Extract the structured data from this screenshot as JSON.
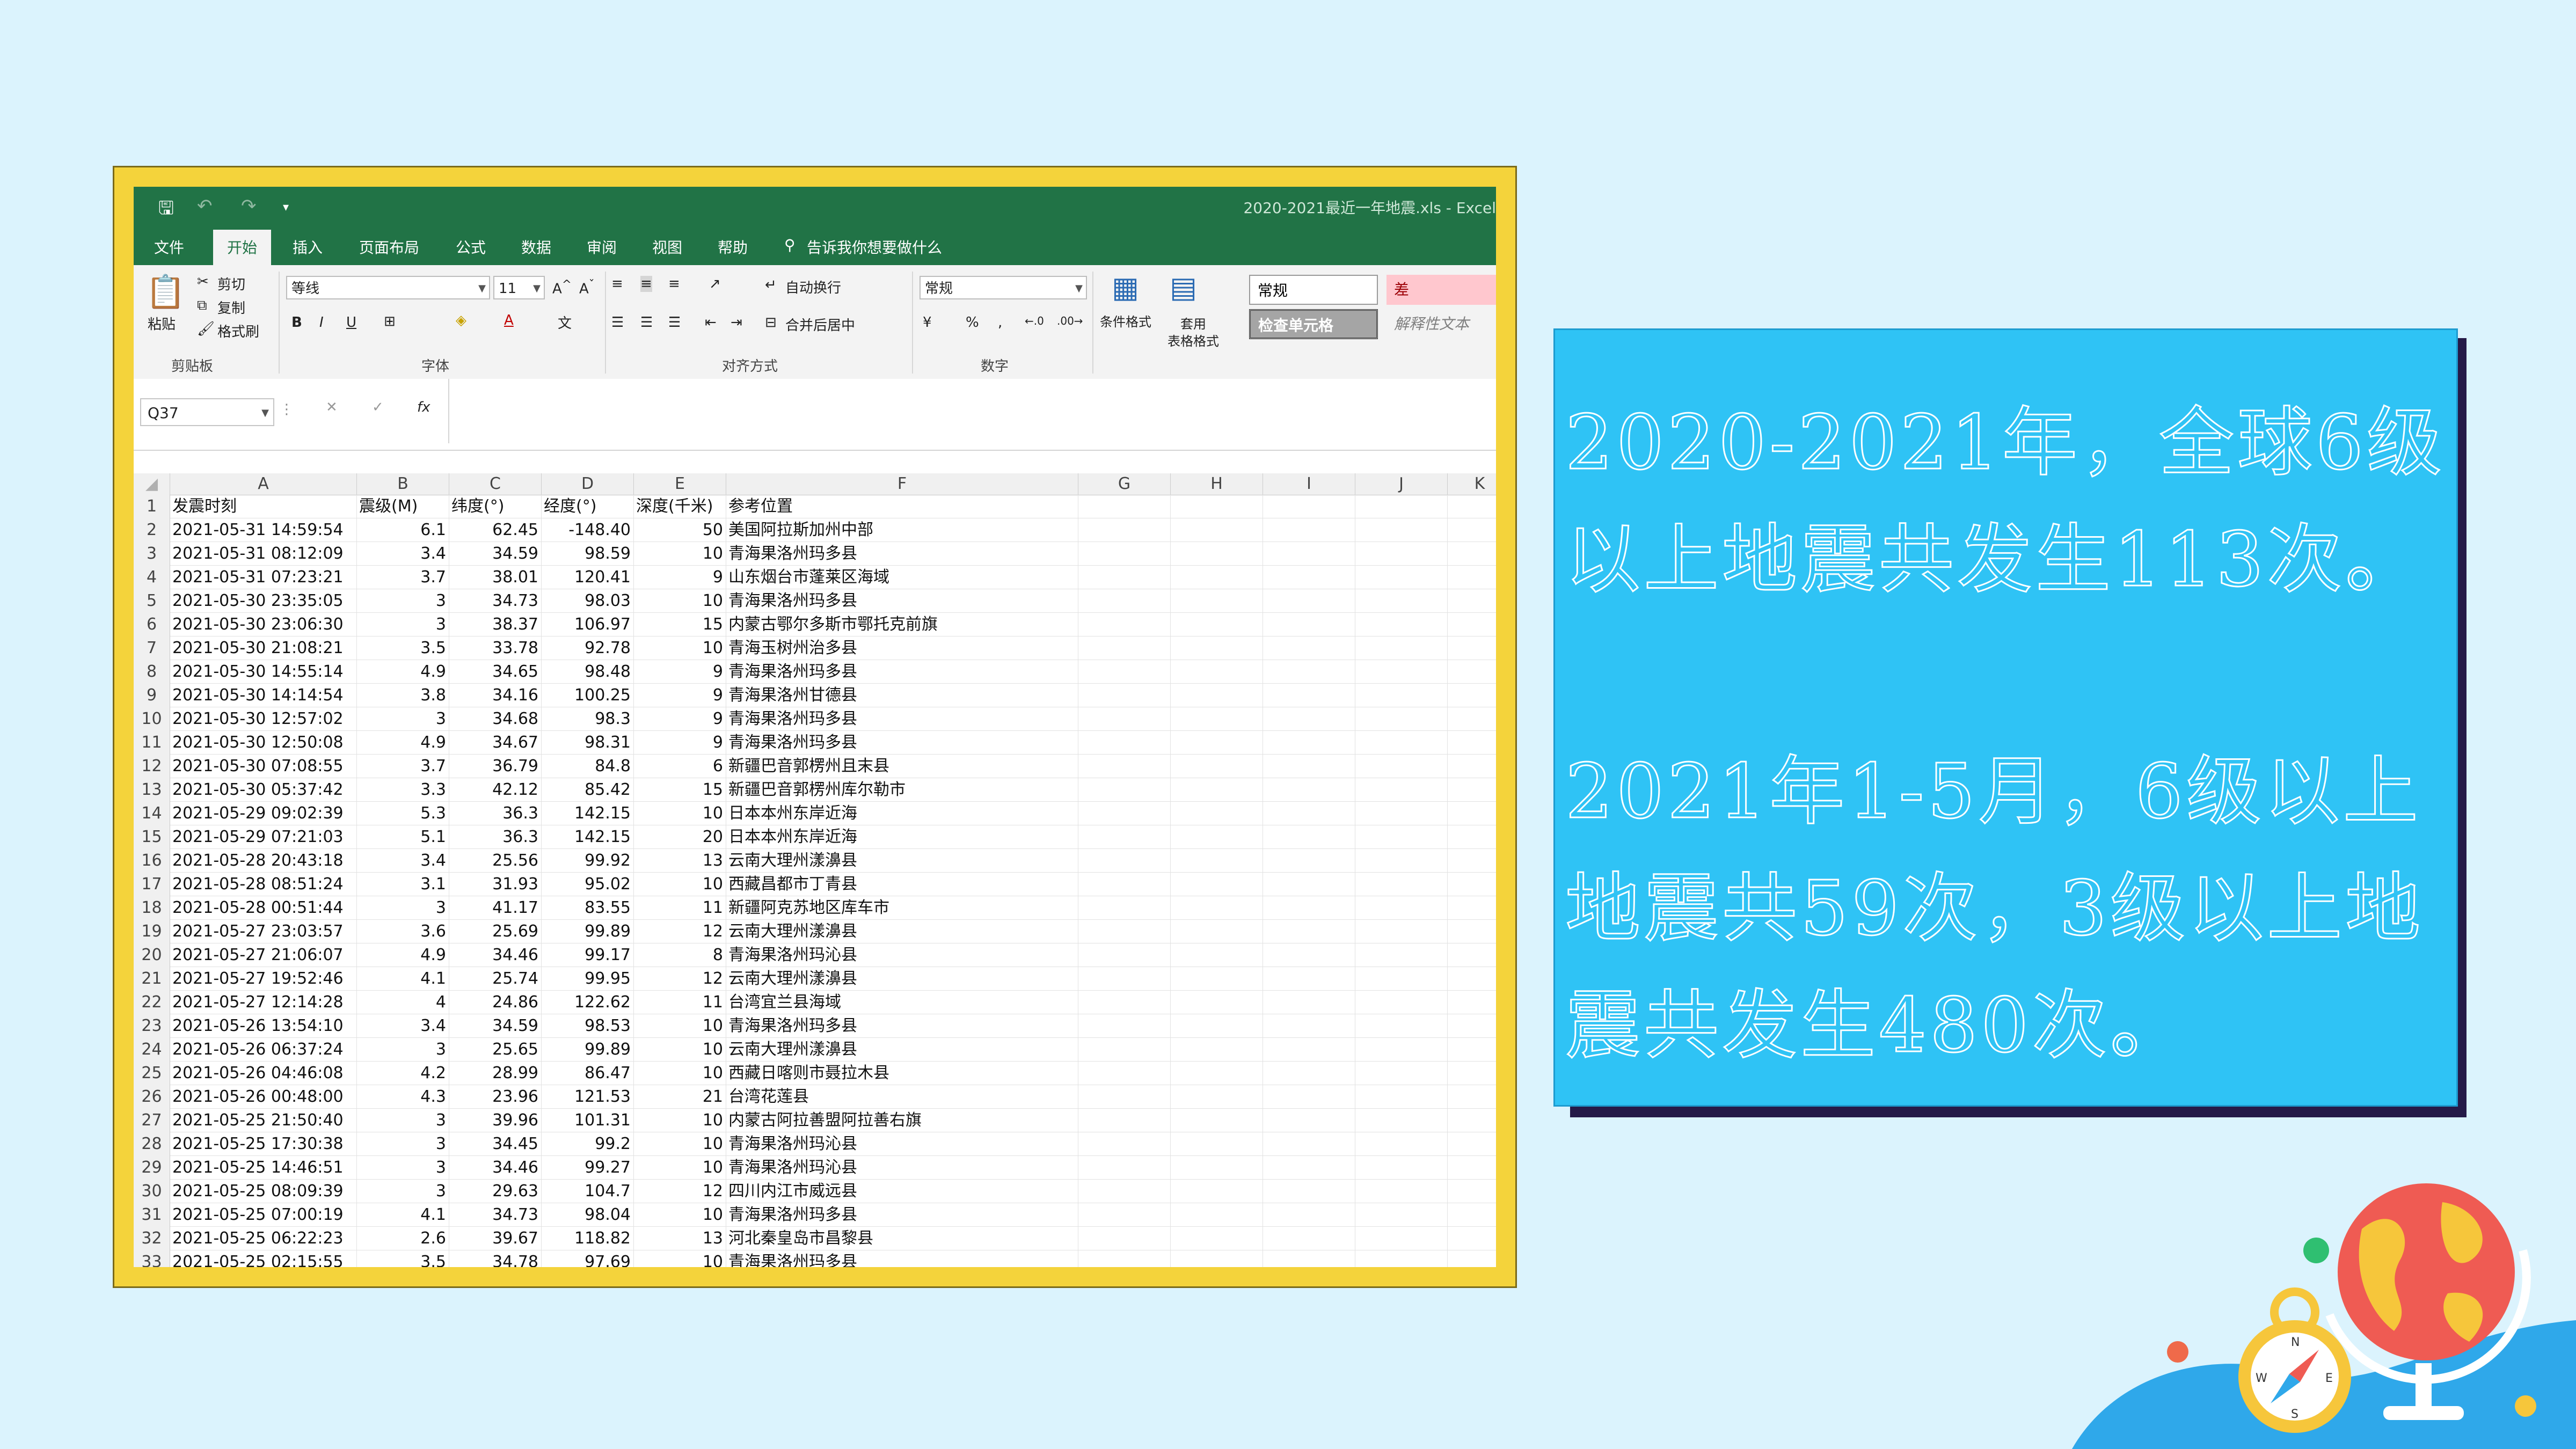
{
  "excel": {
    "doc_title": "2020-2021最近一年地震.xls  -  Excel",
    "tabs": [
      "文件",
      "开始",
      "插入",
      "页面布局",
      "公式",
      "数据",
      "审阅",
      "视图",
      "帮助"
    ],
    "active_tab": "开始",
    "tell_me": "告诉我你想要做什么",
    "ribbon": {
      "paste": "粘贴",
      "cut": "剪切",
      "copy": "复制",
      "format_painter": "格式刷",
      "clipboard_group": "剪贴板",
      "font_name": "等线",
      "font_size": "11",
      "font_group": "字体",
      "wrap_text": "自动换行",
      "merge_center": "合并后居中",
      "alignment_group": "对齐方式",
      "number_format": "常规",
      "number_group": "数字",
      "conditional_format": "条件格式",
      "format_table_1": "套用",
      "format_table_2": "表格格式",
      "style_normal": "常规",
      "style_bad": "差",
      "style_check": "检查单元格",
      "style_explain": "解释性文本"
    },
    "name_box": "Q37",
    "columns": [
      "A",
      "B",
      "C",
      "D",
      "E",
      "F",
      "G",
      "H",
      "I",
      "J",
      "K"
    ],
    "headers": [
      "发震时刻",
      "震级(M)",
      "纬度(°)",
      "经度(°)",
      "深度(千米)",
      "参考位置"
    ],
    "rows": [
      [
        "2021-05-31 14:59:54",
        "6.1",
        "62.45",
        "-148.40",
        "50",
        "美国阿拉斯加州中部"
      ],
      [
        "2021-05-31 08:12:09",
        "3.4",
        "34.59",
        "98.59",
        "10",
        "青海果洛州玛多县"
      ],
      [
        "2021-05-31 07:23:21",
        "3.7",
        "38.01",
        "120.41",
        "9",
        "山东烟台市蓬莱区海域"
      ],
      [
        "2021-05-30 23:35:05",
        "3",
        "34.73",
        "98.03",
        "10",
        "青海果洛州玛多县"
      ],
      [
        "2021-05-30 23:06:30",
        "3",
        "38.37",
        "106.97",
        "15",
        "内蒙古鄂尔多斯市鄂托克前旗"
      ],
      [
        "2021-05-30 21:08:21",
        "3.5",
        "33.78",
        "92.78",
        "10",
        "青海玉树州治多县"
      ],
      [
        "2021-05-30 14:55:14",
        "4.9",
        "34.65",
        "98.48",
        "9",
        "青海果洛州玛多县"
      ],
      [
        "2021-05-30 14:14:54",
        "3.8",
        "34.16",
        "100.25",
        "9",
        "青海果洛州甘德县"
      ],
      [
        "2021-05-30 12:57:02",
        "3",
        "34.68",
        "98.3",
        "9",
        "青海果洛州玛多县"
      ],
      [
        "2021-05-30 12:50:08",
        "4.9",
        "34.67",
        "98.31",
        "9",
        "青海果洛州玛多县"
      ],
      [
        "2021-05-30 07:08:55",
        "3.7",
        "36.79",
        "84.8",
        "6",
        "新疆巴音郭楞州且末县"
      ],
      [
        "2021-05-30 05:37:42",
        "3.3",
        "42.12",
        "85.42",
        "15",
        "新疆巴音郭楞州库尔勒市"
      ],
      [
        "2021-05-29 09:02:39",
        "5.3",
        "36.3",
        "142.15",
        "10",
        "日本本州东岸近海"
      ],
      [
        "2021-05-29 07:21:03",
        "5.1",
        "36.3",
        "142.15",
        "20",
        "日本本州东岸近海"
      ],
      [
        "2021-05-28 20:43:18",
        "3.4",
        "25.56",
        "99.92",
        "13",
        "云南大理州漾濞县"
      ],
      [
        "2021-05-28 08:51:24",
        "3.1",
        "31.93",
        "95.02",
        "10",
        "西藏昌都市丁青县"
      ],
      [
        "2021-05-28 00:51:44",
        "3",
        "41.17",
        "83.55",
        "11",
        "新疆阿克苏地区库车市"
      ],
      [
        "2021-05-27 23:03:57",
        "3.6",
        "25.69",
        "99.89",
        "12",
        "云南大理州漾濞县"
      ],
      [
        "2021-05-27 21:06:07",
        "4.9",
        "34.46",
        "99.17",
        "8",
        "青海果洛州玛沁县"
      ],
      [
        "2021-05-27 19:52:46",
        "4.1",
        "25.74",
        "99.95",
        "12",
        "云南大理州漾濞县"
      ],
      [
        "2021-05-27 12:14:28",
        "4",
        "24.86",
        "122.62",
        "11",
        "台湾宜兰县海域"
      ],
      [
        "2021-05-26 13:54:10",
        "3.4",
        "34.59",
        "98.53",
        "10",
        "青海果洛州玛多县"
      ],
      [
        "2021-05-26 06:37:24",
        "3",
        "25.65",
        "99.89",
        "10",
        "云南大理州漾濞县"
      ],
      [
        "2021-05-26 04:46:08",
        "4.2",
        "28.99",
        "86.47",
        "10",
        "西藏日喀则市聂拉木县"
      ],
      [
        "2021-05-26 00:48:00",
        "4.3",
        "23.96",
        "121.53",
        "21",
        "台湾花莲县"
      ],
      [
        "2021-05-25 21:50:40",
        "3",
        "39.96",
        "101.31",
        "10",
        "内蒙古阿拉善盟阿拉善右旗"
      ],
      [
        "2021-05-25 17:30:38",
        "3",
        "34.45",
        "99.2",
        "10",
        "青海果洛州玛沁县"
      ],
      [
        "2021-05-25 14:46:51",
        "3",
        "34.46",
        "99.27",
        "10",
        "青海果洛州玛沁县"
      ],
      [
        "2021-05-25 08:09:39",
        "3",
        "29.63",
        "104.7",
        "12",
        "四川内江市威远县"
      ],
      [
        "2021-05-25 07:00:19",
        "4.1",
        "34.73",
        "98.04",
        "10",
        "青海果洛州玛多县"
      ],
      [
        "2021-05-25 06:22:23",
        "2.6",
        "39.67",
        "118.82",
        "13",
        "河北秦皇岛市昌黎县"
      ],
      [
        "2021-05-25 02:15:55",
        "3.5",
        "34.78",
        "97.69",
        "10",
        "青海果洛州玛多县"
      ]
    ]
  },
  "info": {
    "lines": [
      "2020-2021年，全球6级",
      "以上地震共发生113次。",
      "2021年1-5月，6级以上",
      "地震共59次，3级以上地",
      "震共发生480次。"
    ]
  },
  "colors": {
    "excel_green": "#217346",
    "frame_yellow": "#f4d33b",
    "panel_blue": "#2fc3f5",
    "background": "#dbf3fd"
  }
}
